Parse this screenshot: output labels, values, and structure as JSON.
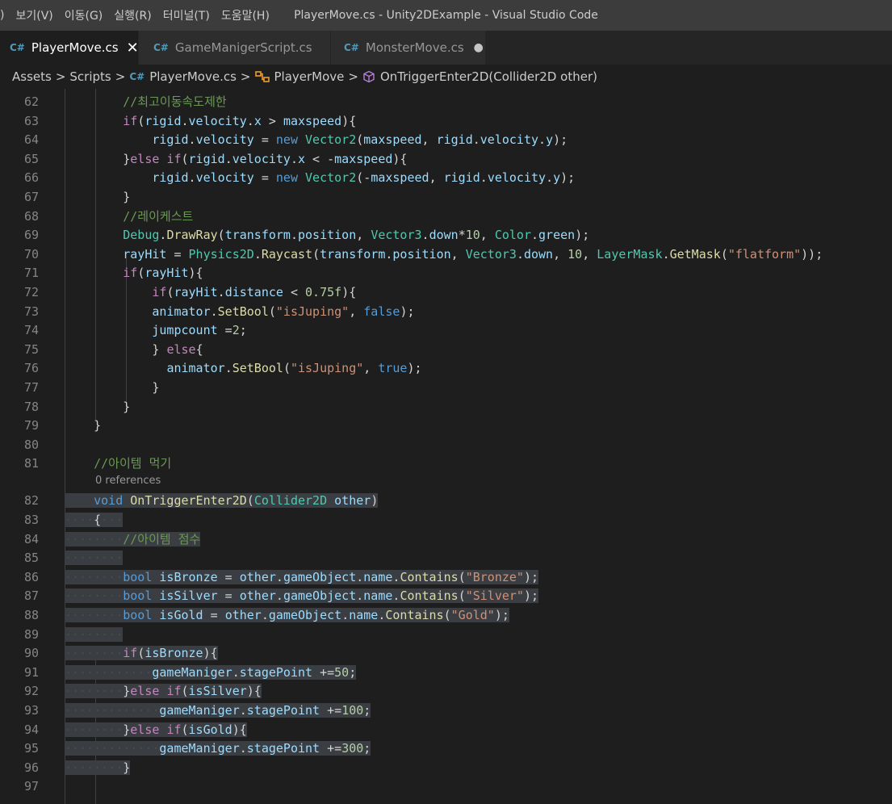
{
  "window": {
    "title": "PlayerMove.cs - Unity2DExample - Visual Studio Code",
    "menu": [
      ")",
      "보기(V)",
      "이동(G)",
      "실행(R)",
      "터미널(T)",
      "도움말(H)"
    ]
  },
  "tabs": [
    {
      "icon": "C#",
      "label": "PlayerMove.cs",
      "active": true,
      "close": "✕"
    },
    {
      "icon": "C#",
      "label": "GameManigerScript.cs",
      "active": false
    },
    {
      "icon": "C#",
      "label": "MonsterMove.cs",
      "active": false,
      "modified": "●"
    }
  ],
  "breadcrumb": {
    "assets": "Assets",
    "scripts": "Scripts",
    "file": "PlayerMove.cs",
    "class": "PlayerMove",
    "method": "OnTriggerEnter2D(Collider2D other)",
    "sep": ">"
  },
  "editor": {
    "codelens": "0 references",
    "lines": [
      {
        "n": "62",
        "text": "        //최고이동속도제한"
      },
      {
        "n": "63",
        "text": "        if(rigid.velocity.x > maxspeed){"
      },
      {
        "n": "64",
        "text": "            rigid.velocity = new Vector2(maxspeed, rigid.velocity.y);"
      },
      {
        "n": "65",
        "text": "        }else if(rigid.velocity.x < -maxspeed){"
      },
      {
        "n": "66",
        "text": "            rigid.velocity = new Vector2(-maxspeed, rigid.velocity.y);"
      },
      {
        "n": "67",
        "text": "        }"
      },
      {
        "n": "68",
        "text": "        //레이케스트"
      },
      {
        "n": "69",
        "text": "        Debug.DrawRay(transform.position, Vector3.down*10, Color.green);"
      },
      {
        "n": "70",
        "text": "        rayHit = Physics2D.Raycast(transform.position, Vector3.down, 10, LayerMask.GetMask(\"flatform\"));"
      },
      {
        "n": "71",
        "text": "        if(rayHit){"
      },
      {
        "n": "72",
        "text": "            if(rayHit.distance < 0.75f){"
      },
      {
        "n": "73",
        "text": "            animator.SetBool(\"isJuping\", false);"
      },
      {
        "n": "74",
        "text": "            jumpcount =2;"
      },
      {
        "n": "75",
        "text": "            } else{"
      },
      {
        "n": "76",
        "text": "              animator.SetBool(\"isJuping\", true);"
      },
      {
        "n": "77",
        "text": "            }"
      },
      {
        "n": "78",
        "text": "        }"
      },
      {
        "n": "79",
        "text": "    }"
      },
      {
        "n": "80",
        "text": ""
      },
      {
        "n": "81",
        "text": "    //아이템 먹기"
      },
      {
        "n": "82",
        "text": "    void OnTriggerEnter2D(Collider2D other)"
      },
      {
        "n": "83",
        "text": "    {"
      },
      {
        "n": "84",
        "text": "        //아이템 점수"
      },
      {
        "n": "85",
        "text": ""
      },
      {
        "n": "86",
        "text": "        bool isBronze = other.gameObject.name.Contains(\"Bronze\");"
      },
      {
        "n": "87",
        "text": "        bool isSilver = other.gameObject.name.Contains(\"Silver\");"
      },
      {
        "n": "88",
        "text": "        bool isGold = other.gameObject.name.Contains(\"Gold\");"
      },
      {
        "n": "89",
        "text": ""
      },
      {
        "n": "90",
        "text": "        if(isBronze){"
      },
      {
        "n": "91",
        "text": "            gameManiger.stagePoint +=50;"
      },
      {
        "n": "92",
        "text": "        }else if(isSilver){"
      },
      {
        "n": "93",
        "text": "             gameManiger.stagePoint +=100;"
      },
      {
        "n": "94",
        "text": "        }else if(isGold){"
      },
      {
        "n": "95",
        "text": "             gameManiger.stagePoint +=300;"
      },
      {
        "n": "96",
        "text": "        }"
      },
      {
        "n": "97",
        "text": ""
      }
    ]
  },
  "colors": {
    "keyword": "#569cd6",
    "control": "#c586c0",
    "type": "#4ec9b0",
    "function": "#dcdcaa",
    "variable": "#9cdcfe",
    "string": "#ce9178",
    "number": "#b5cea8",
    "comment": "#6a9955",
    "selection": "#3a3d41"
  }
}
